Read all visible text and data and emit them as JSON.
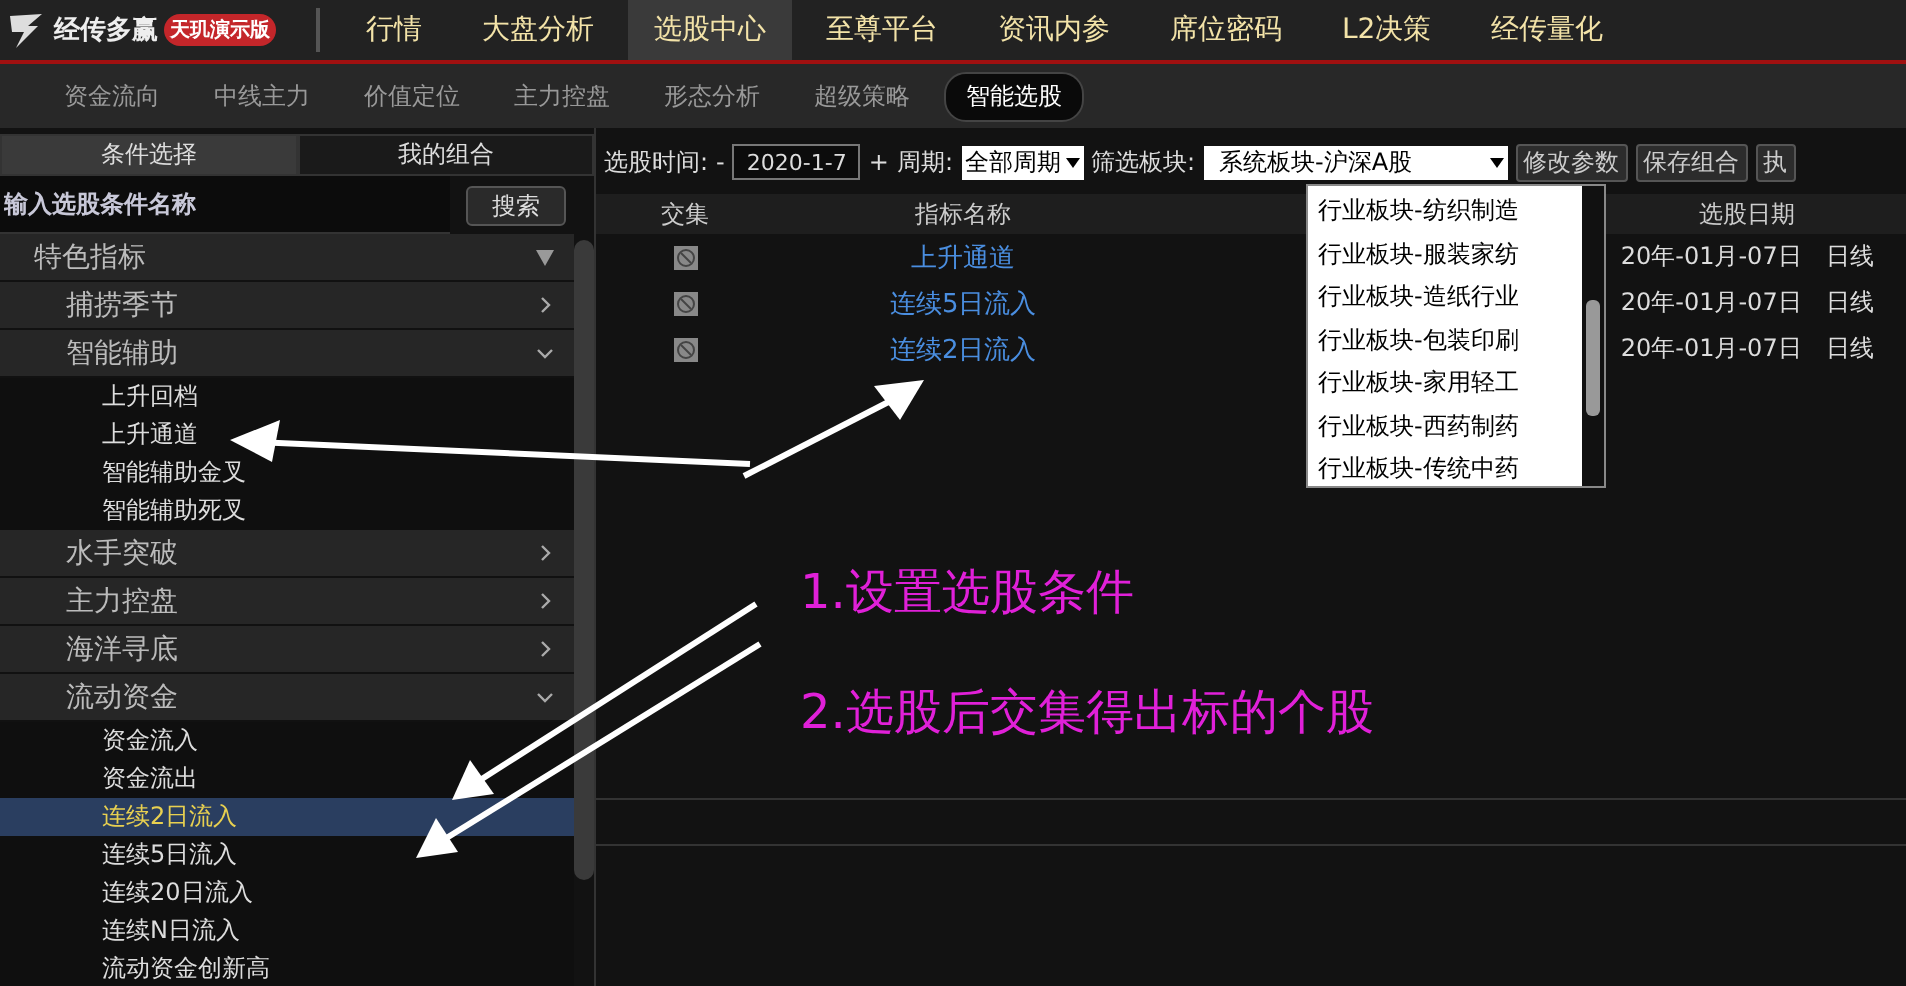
{
  "app": {
    "name": "经传多赢",
    "edition": "天玑演示版"
  },
  "main_nav": [
    {
      "label": "行情",
      "selected": false
    },
    {
      "label": "大盘分析",
      "selected": false
    },
    {
      "label": "选股中心",
      "selected": true
    },
    {
      "label": "至尊平台",
      "selected": false
    },
    {
      "label": "资讯内参",
      "selected": false
    },
    {
      "label": "席位密码",
      "selected": false
    },
    {
      "label": "L2决策",
      "selected": false
    },
    {
      "label": "经传量化",
      "selected": false
    }
  ],
  "sub_nav": [
    {
      "label": "资金流向",
      "selected": false
    },
    {
      "label": "中线主力",
      "selected": false
    },
    {
      "label": "价值定位",
      "selected": false
    },
    {
      "label": "主力控盘",
      "selected": false
    },
    {
      "label": "形态分析",
      "selected": false
    },
    {
      "label": "超级策略",
      "selected": false
    },
    {
      "label": "智能选股",
      "selected": true
    }
  ],
  "sidebar": {
    "tabs": [
      {
        "label": "条件选择",
        "selected": true
      },
      {
        "label": "我的组合",
        "selected": false
      }
    ],
    "search": {
      "placeholder": "输入选股条件名称",
      "button": "搜索"
    },
    "tree": [
      {
        "label": "特色指标",
        "expanded": true,
        "children": [
          {
            "label": "捕捞季节",
            "expanded": false
          },
          {
            "label": "智能辅助",
            "expanded": true,
            "children": [
              {
                "label": "上升回档",
                "selected": false
              },
              {
                "label": "上升通道",
                "selected": false
              },
              {
                "label": "智能辅助金叉",
                "selected": false
              },
              {
                "label": "智能辅助死叉",
                "selected": false
              }
            ]
          },
          {
            "label": "水手突破",
            "expanded": false
          },
          {
            "label": "主力控盘",
            "expanded": false
          },
          {
            "label": "海洋寻底",
            "expanded": false
          },
          {
            "label": "流动资金",
            "expanded": true,
            "children": [
              {
                "label": "资金流入",
                "selected": false
              },
              {
                "label": "资金流出",
                "selected": false
              },
              {
                "label": "连续2日流入",
                "selected": true
              },
              {
                "label": "连续5日流入",
                "selected": false
              },
              {
                "label": "连续20日流入",
                "selected": false
              },
              {
                "label": "连续N日流入",
                "selected": false
              },
              {
                "label": "流动资金创新高",
                "selected": false
              }
            ]
          }
        ]
      }
    ]
  },
  "toolbar": {
    "time_label": "选股时间:",
    "minus": "-",
    "date": "2020-1-7",
    "plus": "+",
    "period_label": "周期:",
    "period": "全部周期",
    "board_label": "筛选板块:",
    "board": "系统板块-沪深A股",
    "buttons": [
      "修改参数",
      "保存组合",
      "执"
    ]
  },
  "board_dropdown": {
    "options": [
      "行业板块-纺织制造",
      "行业板块-服装家纺",
      "行业板块-造纸行业",
      "行业板块-包装印刷",
      "行业板块-家用轻工",
      "行业板块-西药制药",
      "行业板块-传统中药"
    ]
  },
  "table": {
    "columns": [
      "交集",
      "指标名称",
      "选股日期"
    ],
    "rows": [
      {
        "name": "上升通道",
        "date": "20年-01月-07日",
        "period": "日线"
      },
      {
        "name": "连续5日流入",
        "date": "20年-01月-07日",
        "period": "日线"
      },
      {
        "name": "连续2日流入",
        "date": "20年-01月-07日",
        "period": "日线"
      }
    ]
  },
  "annotations": [
    "1.设置选股条件",
    "2.选股后交集得出标的个股"
  ]
}
